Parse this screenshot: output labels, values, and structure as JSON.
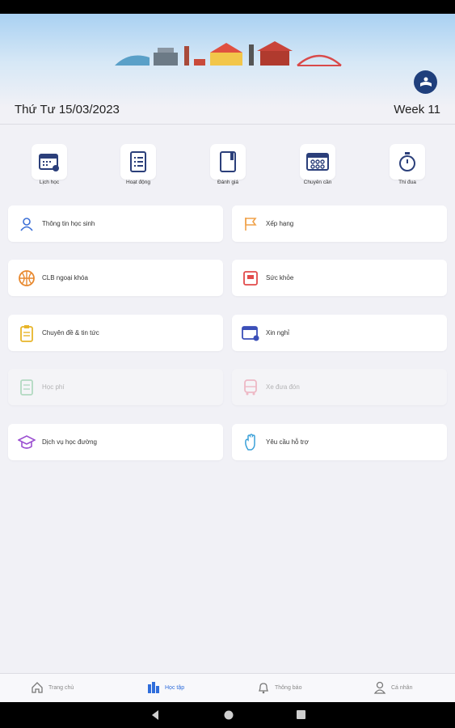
{
  "header": {
    "date": "Thứ Tư 15/03/2023",
    "week": "Week 11"
  },
  "quick_actions": [
    {
      "label": "Lịch học",
      "icon": "calendar-icon"
    },
    {
      "label": "Hoạt động",
      "icon": "checklist-icon"
    },
    {
      "label": "Đánh giá",
      "icon": "notebook-icon"
    },
    {
      "label": "Chuyên cần",
      "icon": "attendance-icon"
    },
    {
      "label": "Thi đua",
      "icon": "stopwatch-icon"
    }
  ],
  "menu": [
    {
      "label": "Thông tin học sinh",
      "icon": "student-icon",
      "color": "#3b6fd6",
      "enabled": true
    },
    {
      "label": "Xếp hạng",
      "icon": "flag-icon",
      "color": "#f0a24a",
      "enabled": true
    },
    {
      "label": "CLB ngoại khóa",
      "icon": "basketball-icon",
      "color": "#e8892f",
      "enabled": true
    },
    {
      "label": "Sức khỏe",
      "icon": "health-icon",
      "color": "#e24b4b",
      "enabled": true
    },
    {
      "label": "Chuyên đề & tin tức",
      "icon": "clipboard-icon",
      "color": "#e8b52a",
      "enabled": true
    },
    {
      "label": "Xin nghỉ",
      "icon": "leave-icon",
      "color": "#3b4fb8",
      "enabled": true
    },
    {
      "label": "Học phí",
      "icon": "fee-icon",
      "color": "#3aa860",
      "enabled": false
    },
    {
      "label": "Xe đưa đón",
      "icon": "bus-icon",
      "color": "#e24b6b",
      "enabled": false
    },
    {
      "label": "Dịch vụ học đường",
      "icon": "graduation-cap-icon",
      "color": "#9b4fd1",
      "enabled": true
    },
    {
      "label": "Yêu cầu hỗ trợ",
      "icon": "support-hand-icon",
      "color": "#3aa0d8",
      "enabled": true
    }
  ],
  "bottom_tabs": [
    {
      "label": "Trang chủ",
      "icon": "home-icon",
      "active": false
    },
    {
      "label": "Học tập",
      "icon": "study-icon",
      "active": true
    },
    {
      "label": "Thông báo",
      "icon": "bell-icon",
      "active": false
    },
    {
      "label": "Cá nhân",
      "icon": "person-icon",
      "active": false
    }
  ],
  "colors": {
    "accent": "#2f6ddb",
    "background": "#f1f1f6",
    "logo": "#1f3f7c"
  }
}
